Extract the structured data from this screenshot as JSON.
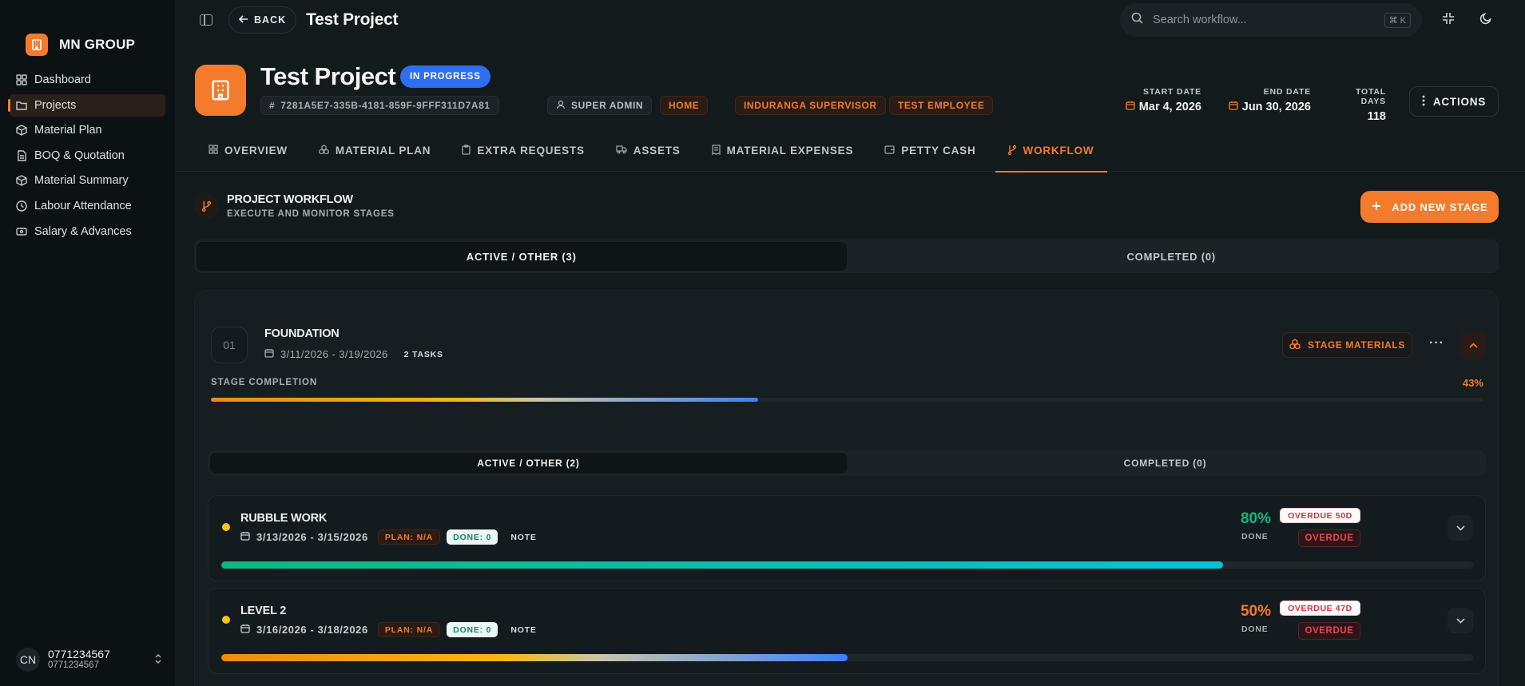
{
  "brand": {
    "name": "MN GROUP"
  },
  "sidebar": {
    "items": [
      {
        "label": "Dashboard"
      },
      {
        "label": "Projects"
      },
      {
        "label": "Material Plan"
      },
      {
        "label": "BOQ & Quotation"
      },
      {
        "label": "Material Summary"
      },
      {
        "label": "Labour Attendance"
      },
      {
        "label": "Salary & Advances"
      }
    ],
    "user": {
      "initials": "CN",
      "name": "0771234567",
      "sub": "0771234567"
    }
  },
  "topbar": {
    "back_label": "BACK",
    "title": "Test Project",
    "search_placeholder": "Search workflow...",
    "search_shortcut": "⌘ K"
  },
  "project": {
    "title": "Test Project",
    "status": "IN PROGRESS",
    "id": "7281A5E7-335B-4181-859F-9FFF311D7A81",
    "role": "SUPER ADMIN",
    "tag": "HOME",
    "supervisor": "INDURANGA SUPERVISOR",
    "employee": "TEST EMPLOYEE",
    "start_label": "START DATE",
    "start_date": "Mar 4, 2026",
    "end_label": "END DATE",
    "end_date": "Jun 30, 2026",
    "total_label": "TOTAL DAYS",
    "total_days": "118",
    "actions_label": "ACTIONS"
  },
  "tabs": [
    {
      "label": "OVERVIEW"
    },
    {
      "label": "MATERIAL PLAN"
    },
    {
      "label": "EXTRA REQUESTS"
    },
    {
      "label": "ASSETS"
    },
    {
      "label": "MATERIAL EXPENSES"
    },
    {
      "label": "PETTY CASH"
    },
    {
      "label": "WORKFLOW"
    }
  ],
  "workflow": {
    "title": "PROJECT WORKFLOW",
    "subtitle": "EXECUTE AND MONITOR STAGES",
    "add_label": "ADD NEW STAGE",
    "seg_active": "ACTIVE / OTHER (3)",
    "seg_completed": "COMPLETED (0)"
  },
  "stage": {
    "number": "01",
    "name": "FOUNDATION",
    "dates": "3/11/2026 - 3/19/2026",
    "tasks": "2 TASKS",
    "materials_label": "STAGE MATERIALS",
    "completion_label": "STAGE COMPLETION",
    "completion_pct": "43%",
    "completion_value": 43,
    "seg_active": "ACTIVE / OTHER (2)",
    "seg_completed": "COMPLETED (0)"
  },
  "tasks": [
    {
      "name": "RUBBLE WORK",
      "dates": "3/13/2026 - 3/15/2026",
      "plan": "PLAN: N/A",
      "done": "DONE: 0",
      "note": "NOTE",
      "pct": "80%",
      "pct_value": 80,
      "done_label": "DONE",
      "overdue_days": "OVERDUE 50D",
      "overdue": "OVERDUE",
      "color": "#10b981"
    },
    {
      "name": "LEVEL 2",
      "dates": "3/16/2026 - 3/18/2026",
      "plan": "PLAN: N/A",
      "done": "DONE: 0",
      "note": "NOTE",
      "pct": "50%",
      "pct_value": 50,
      "done_label": "DONE",
      "overdue_days": "OVERDUE 47D",
      "overdue": "OVERDUE",
      "color": "#f47a2c"
    }
  ],
  "colors": {
    "accent": "#f47a2c",
    "status_blue": "#2d6ff0",
    "success": "#10b981",
    "danger": "#ef4450"
  }
}
